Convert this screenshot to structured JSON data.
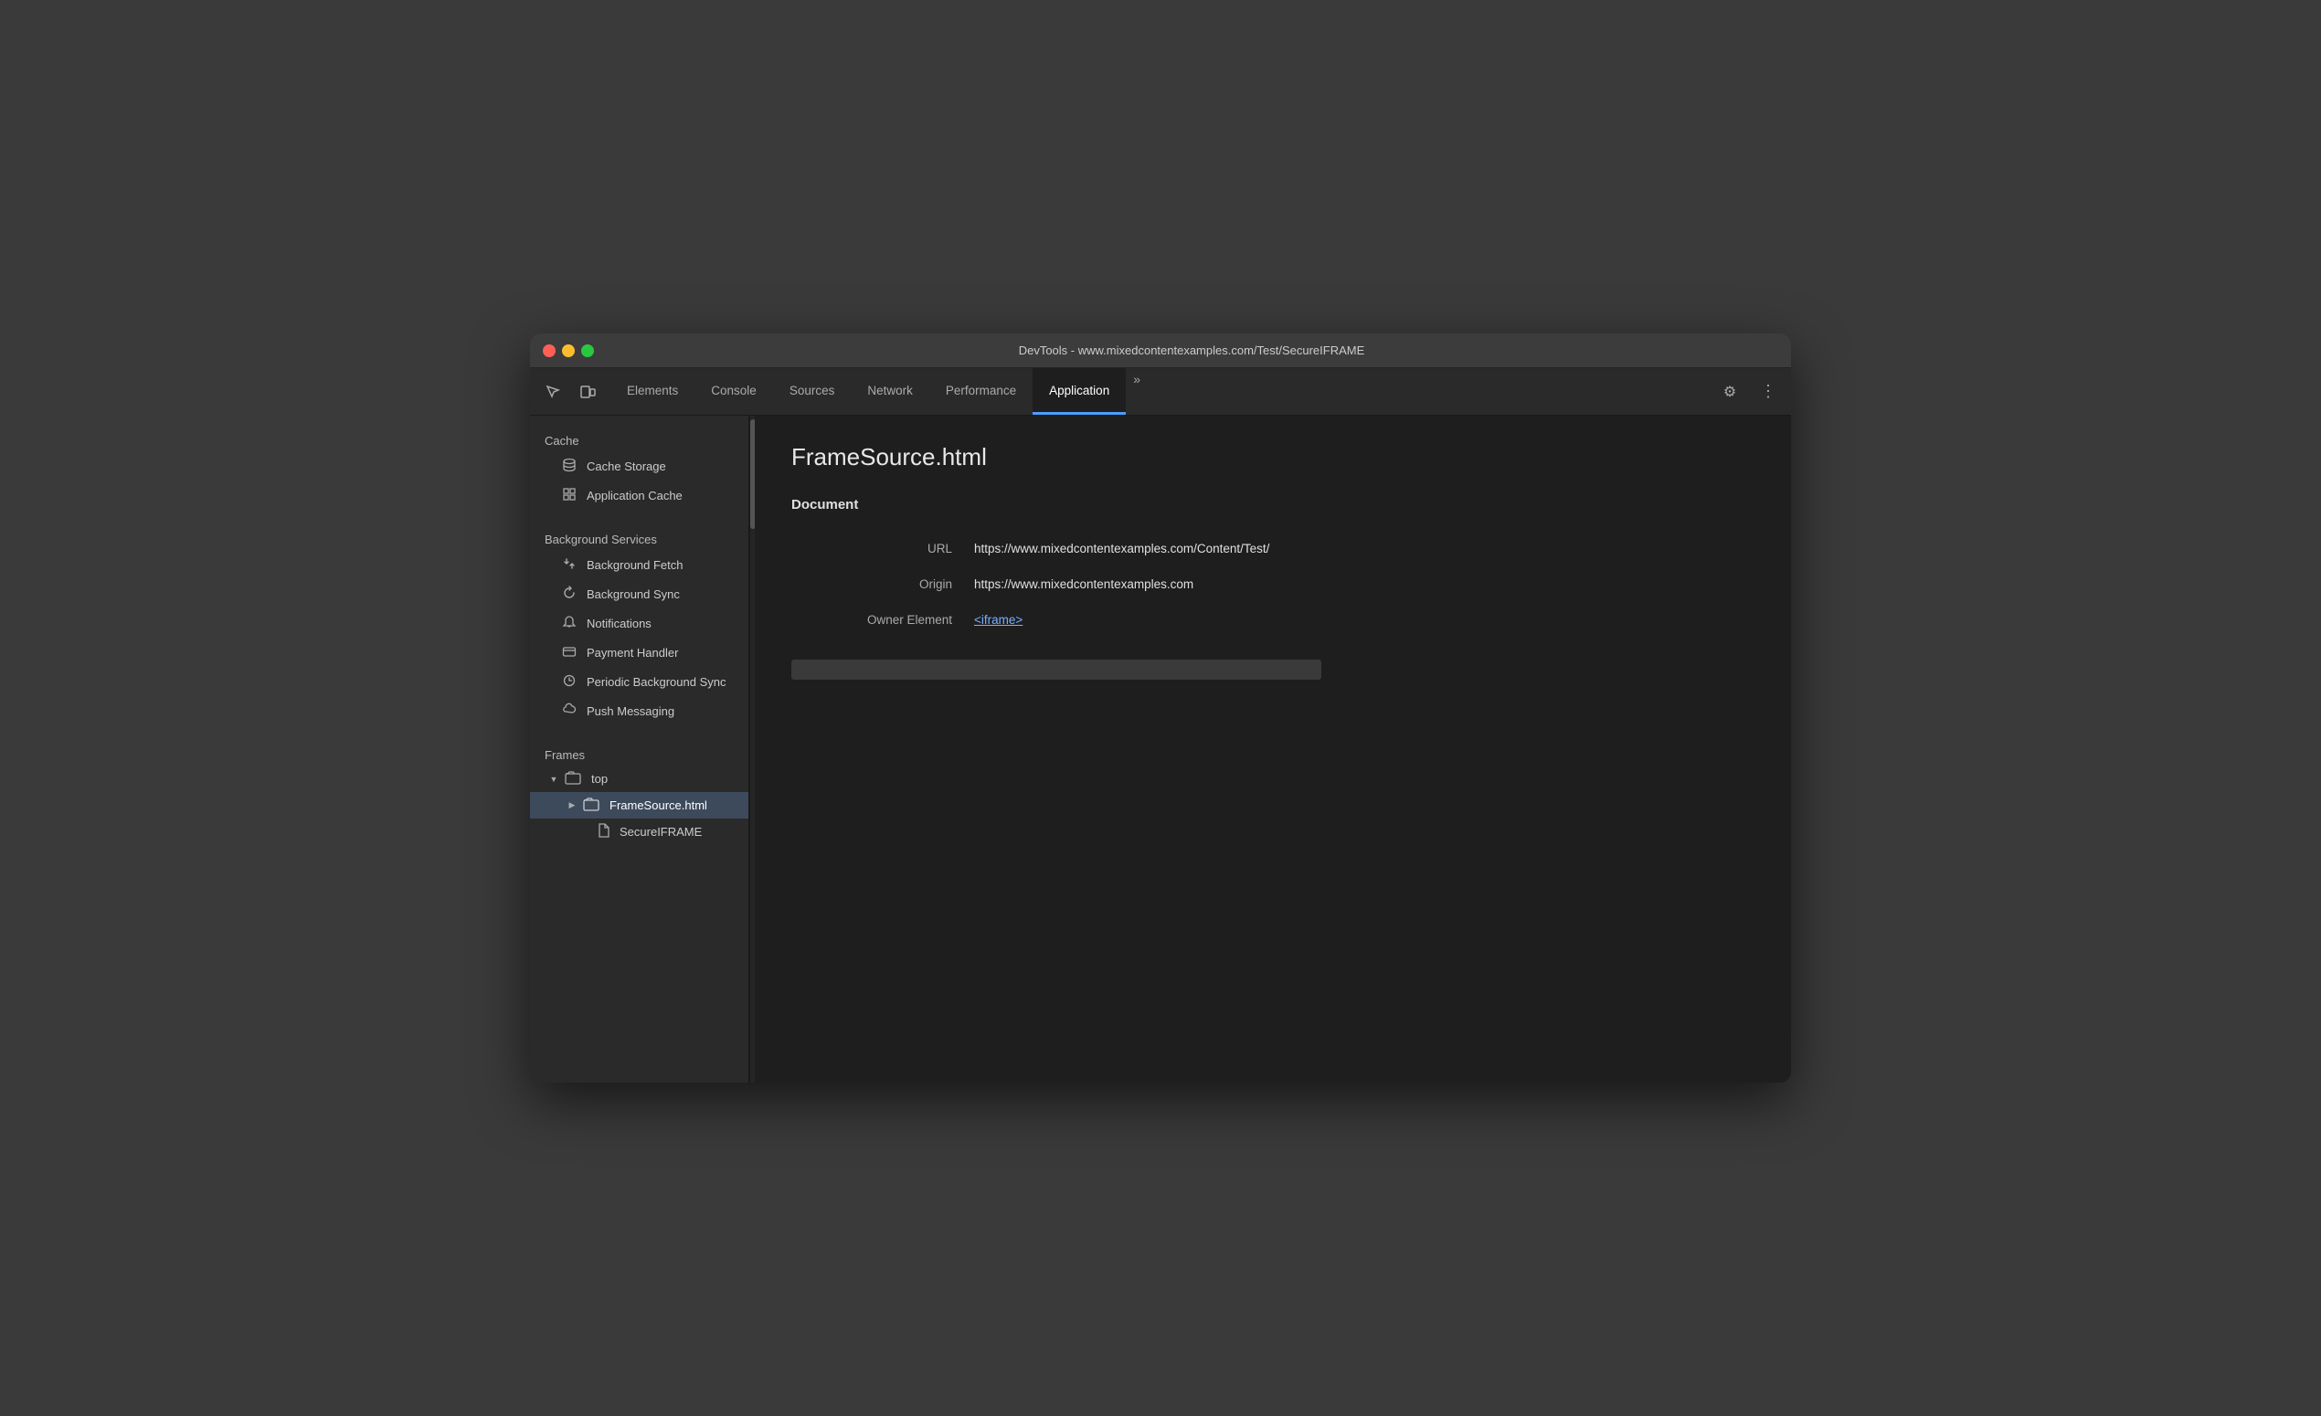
{
  "window": {
    "title": "DevTools - www.mixedcontentexamples.com/Test/SecureIFRAME"
  },
  "toolbar": {
    "tabs": [
      {
        "id": "elements",
        "label": "Elements",
        "active": false
      },
      {
        "id": "console",
        "label": "Console",
        "active": false
      },
      {
        "id": "sources",
        "label": "Sources",
        "active": false
      },
      {
        "id": "network",
        "label": "Network",
        "active": false
      },
      {
        "id": "performance",
        "label": "Performance",
        "active": false
      },
      {
        "id": "application",
        "label": "Application",
        "active": true
      }
    ],
    "more_label": "»",
    "settings_icon": "⚙",
    "menu_icon": "⋮"
  },
  "sidebar": {
    "cache_section": "Cache",
    "cache_items": [
      {
        "id": "cache-storage",
        "label": "Cache Storage",
        "icon": "db"
      },
      {
        "id": "application-cache",
        "label": "Application Cache",
        "icon": "grid"
      }
    ],
    "bg_services_section": "Background Services",
    "bg_items": [
      {
        "id": "background-fetch",
        "label": "Background Fetch",
        "icon": "arrows"
      },
      {
        "id": "background-sync",
        "label": "Background Sync",
        "icon": "sync"
      },
      {
        "id": "notifications",
        "label": "Notifications",
        "icon": "bell"
      },
      {
        "id": "payment-handler",
        "label": "Payment Handler",
        "icon": "card"
      },
      {
        "id": "periodic-background-sync",
        "label": "Periodic Background Sync",
        "icon": "clock"
      },
      {
        "id": "push-messaging",
        "label": "Push Messaging",
        "icon": "cloud"
      }
    ],
    "frames_section": "Frames",
    "frames_items": [
      {
        "id": "top",
        "label": "top",
        "level": 1,
        "type": "folder",
        "open": true
      },
      {
        "id": "framesource",
        "label": "FrameSource.html",
        "level": 2,
        "type": "folder",
        "open": false,
        "active": true
      },
      {
        "id": "secureiframe",
        "label": "SecureIFRAME",
        "level": 2,
        "type": "file"
      }
    ]
  },
  "content": {
    "title": "FrameSource.html",
    "section": "Document",
    "url_label": "URL",
    "url_value": "https://www.mixedcontentexamples.com/Content/Test/",
    "origin_label": "Origin",
    "origin_value": "https://www.mixedcontentexamples.com",
    "owner_label": "Owner Element",
    "owner_value": "<iframe>"
  }
}
